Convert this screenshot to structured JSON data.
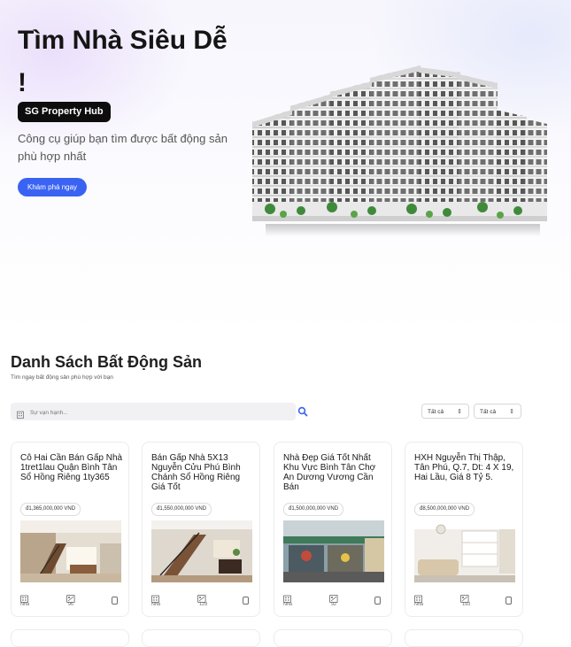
{
  "hero": {
    "title": "Tìm Nhà Siêu Dễ !",
    "badge": "SG Property Hub",
    "subtitle": "Công cụ giúp bạn tìm được bất động sản phù hợp nhất",
    "cta": "Khám phá ngay"
  },
  "listing": {
    "title": "Danh Sách Bất Động Sản",
    "subtitle": "Tìm ngay bất động sản phù hợp với bạn",
    "search_placeholder": "Sự vạn hạnh...",
    "filter1": "Tất cả",
    "filter2": "Tất cả"
  },
  "cards": [
    {
      "title": "Cô Hai Cần Bán Gấp Nhà 1tret1lau Quận Bình Tân Sổ Hồng Riêng 1ty365",
      "price": "đ1,365,000,000 VND",
      "type": "Nhà",
      "area": "96"
    },
    {
      "title": "Bán Gấp Nhà 5X13 Nguyễn Cửu Phú Bình Chánh Sổ Hồng Riêng Giá Tốt",
      "price": "đ1,550,000,000 VND",
      "type": "Nhà",
      "area": "129"
    },
    {
      "title": "Nhà Đẹp Giá Tốt Nhất Khu Vực Bình Tân Chợ An Dương Vương Cần Bán",
      "price": "đ1,500,000,000 VND",
      "type": "Nhà",
      "area": "92"
    },
    {
      "title": "HXH Nguyễn Thị Thập, Tân Phú, Q.7, Dt: 4 X 19, Hai Lầu, Giá 8 Tỷ 5.",
      "price": "đ8,500,000,000 VND",
      "type": "Nhà",
      "area": "193"
    }
  ],
  "colors": {
    "accent": "#3a63f3",
    "badge_bg": "#0d0d0d"
  },
  "icons": {
    "search": "search-icon",
    "building": "building-icon",
    "area": "area-icon",
    "save": "bookmark-icon",
    "chevron": "chevron-updown-icon"
  }
}
